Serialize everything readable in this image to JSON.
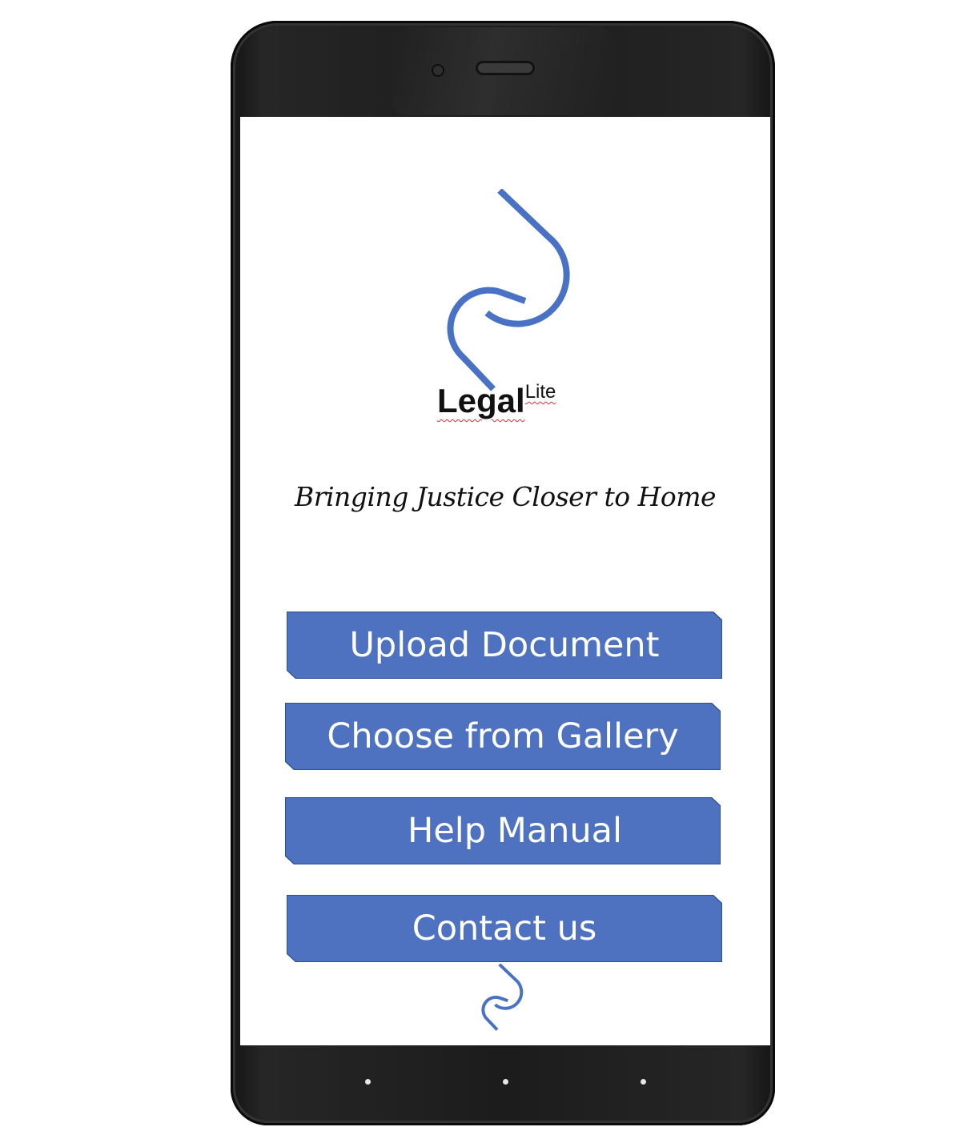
{
  "brand": {
    "name": "Legal",
    "superscript": "Lite"
  },
  "tagline": "Bringing Justice Closer to Home",
  "buttons": {
    "upload": "Upload Document",
    "gallery": "Choose from Gallery",
    "help": "Help Manual",
    "contact": "Contact us"
  },
  "colors": {
    "accent": "#4e72c0",
    "logo": "#4a72c4",
    "device": "#1c1c1c"
  },
  "icons": {
    "top_logo": "legallite-logo-icon",
    "bottom_logo": "legallite-logo-small-icon"
  }
}
